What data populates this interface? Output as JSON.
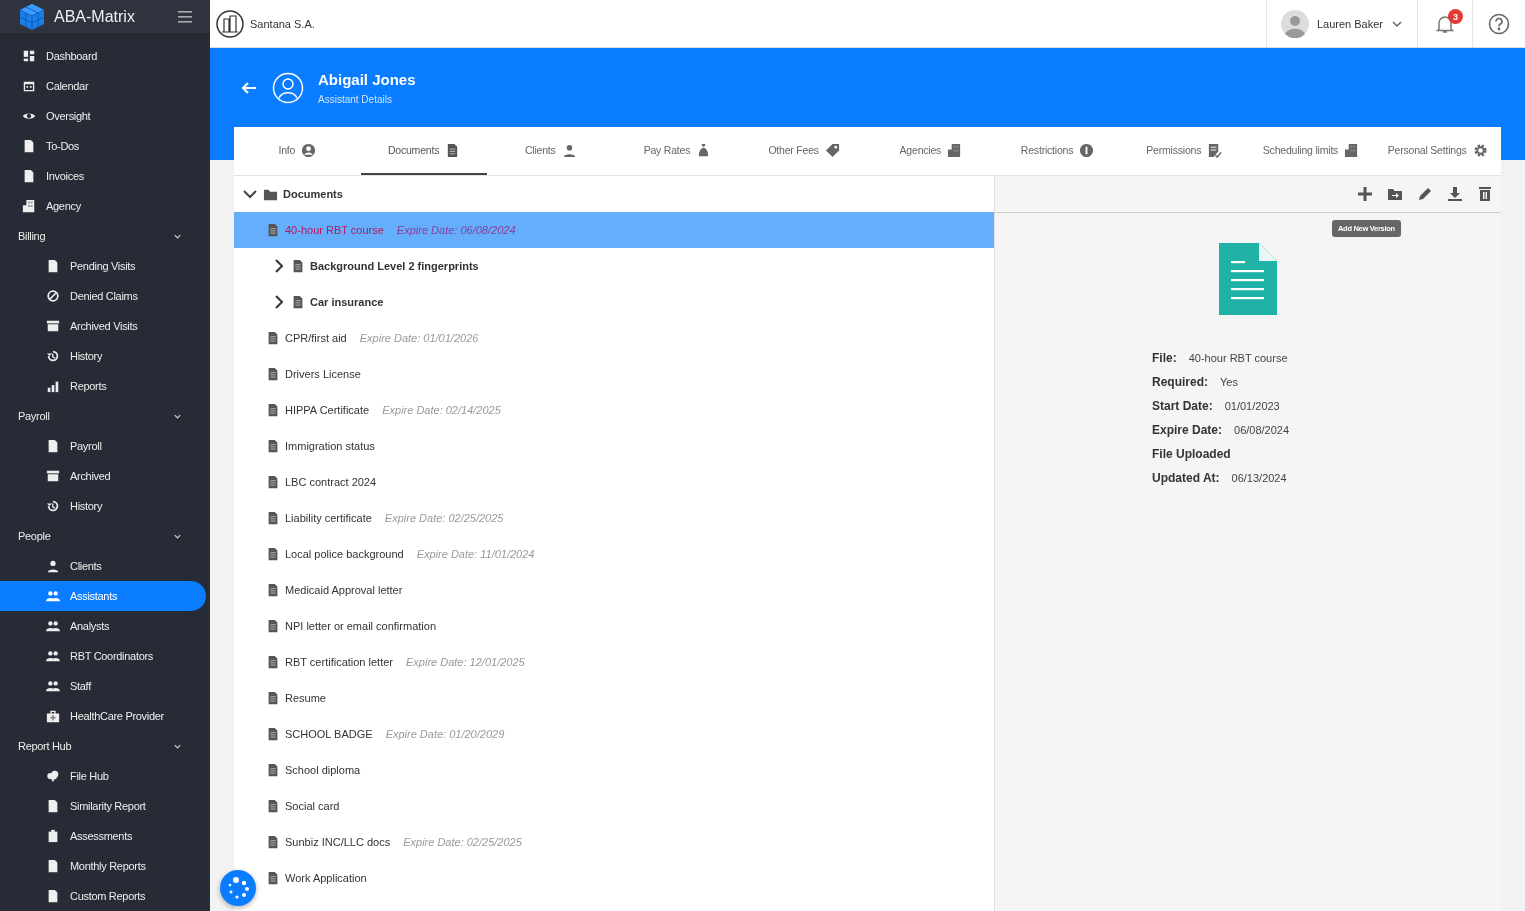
{
  "sidebar": {
    "brand": "ABA-Matrix",
    "items": [
      {
        "label": "Dashboard",
        "selected": false
      },
      {
        "label": "Calendar",
        "selected": false
      },
      {
        "label": "Oversight",
        "selected": false
      },
      {
        "label": "To-Dos",
        "selected": false
      },
      {
        "label": "Invoices",
        "selected": false
      },
      {
        "label": "Agency",
        "selected": false
      }
    ],
    "sections": [
      {
        "title": "Billing",
        "expanded": true,
        "items": [
          {
            "label": "Pending Visits",
            "selected": false
          },
          {
            "label": "Denied Claims",
            "selected": false
          },
          {
            "label": "Archived Visits",
            "selected": false
          },
          {
            "label": "History",
            "selected": false
          },
          {
            "label": "Reports",
            "selected": false
          }
        ]
      },
      {
        "title": "Payroll",
        "expanded": true,
        "items": [
          {
            "label": "Payroll",
            "selected": false
          },
          {
            "label": "Archived",
            "selected": false
          },
          {
            "label": "History",
            "selected": false
          }
        ]
      },
      {
        "title": "People",
        "expanded": true,
        "items": [
          {
            "label": "Clients",
            "selected": false
          },
          {
            "label": "Assistants",
            "selected": true
          },
          {
            "label": "Analysts",
            "selected": false
          },
          {
            "label": "RBT Coordinators",
            "selected": false
          },
          {
            "label": "Staff",
            "selected": false
          },
          {
            "label": "HealthCare Provider",
            "selected": false
          }
        ]
      },
      {
        "title": "Report Hub",
        "expanded": true,
        "items": [
          {
            "label": "File Hub",
            "selected": false
          },
          {
            "label": "Similarity Report",
            "selected": false
          },
          {
            "label": "Assessments",
            "selected": false
          },
          {
            "label": "Monthly Reports",
            "selected": false
          },
          {
            "label": "Custom Reports",
            "selected": false
          }
        ]
      }
    ]
  },
  "topbar": {
    "company": "Santana S.A.",
    "user": "Lauren Baker",
    "notifications": "3"
  },
  "header": {
    "name": "Abigail Jones",
    "subtitle": "Assistant Details"
  },
  "tabs": [
    {
      "label": "Info",
      "selected": false
    },
    {
      "label": "Documents",
      "selected": true
    },
    {
      "label": "Clients",
      "selected": false
    },
    {
      "label": "Pay Rates",
      "selected": false
    },
    {
      "label": "Other Fees",
      "selected": false
    },
    {
      "label": "Agencies",
      "selected": false
    },
    {
      "label": "Restrictions",
      "selected": false
    },
    {
      "label": "Permissions",
      "selected": false
    },
    {
      "label": "Scheduling limits",
      "selected": false
    },
    {
      "label": "Personal Settings",
      "selected": false
    }
  ],
  "tree": {
    "label": "Documents",
    "expanded": true,
    "children": [
      {
        "kind": "file",
        "label": "40-hour RBT course",
        "expire": "Expire Date: 06/08/2024",
        "selected": true
      },
      {
        "kind": "folder",
        "label": "Background Level 2 fingerprints",
        "expanded": false,
        "selected": false
      },
      {
        "kind": "folder",
        "label": "Car insurance",
        "expanded": false,
        "selected": false
      },
      {
        "kind": "file",
        "label": "CPR/first aid",
        "expire": "Expire Date: 01/01/2026",
        "selected": false
      },
      {
        "kind": "file",
        "label": "Drivers License",
        "selected": false
      },
      {
        "kind": "file",
        "label": "HIPPA Certificate",
        "expire": "Expire Date: 02/14/2025",
        "selected": false
      },
      {
        "kind": "file",
        "label": "Immigration status",
        "selected": false
      },
      {
        "kind": "file",
        "label": "LBC contract 2024",
        "selected": false
      },
      {
        "kind": "file",
        "label": "Liability certificate",
        "expire": "Expire Date: 02/25/2025",
        "selected": false
      },
      {
        "kind": "file",
        "label": "Local police background",
        "expire": "Expire Date: 11/01/2024",
        "selected": false
      },
      {
        "kind": "file",
        "label": "Medicaid Approval letter",
        "selected": false
      },
      {
        "kind": "file",
        "label": "NPI letter or email confirmation",
        "selected": false
      },
      {
        "kind": "file",
        "label": "RBT certification letter",
        "expire": "Expire Date: 12/01/2025",
        "selected": false
      },
      {
        "kind": "file",
        "label": "Resume",
        "selected": false
      },
      {
        "kind": "file",
        "label": "SCHOOL BADGE",
        "expire": "Expire Date: 01/20/2029",
        "selected": false
      },
      {
        "kind": "file",
        "label": "School diploma",
        "selected": false
      },
      {
        "kind": "file",
        "label": "Social card",
        "selected": false
      },
      {
        "kind": "file",
        "label": "Sunbiz INC/LLC docs",
        "expire": "Expire Date: 02/25/2025",
        "selected": false
      },
      {
        "kind": "file",
        "label": "Work Application",
        "selected": false
      }
    ]
  },
  "detail": {
    "tooltip": "Add New Version",
    "fields": [
      {
        "label": "File:",
        "value": "40-hour RBT course"
      },
      {
        "label": "Required:",
        "value": "Yes"
      },
      {
        "label": "Start Date:",
        "value": "01/01/2023"
      },
      {
        "label": "Expire Date:",
        "value": "06/08/2024"
      },
      {
        "label": "File Uploaded"
      },
      {
        "label": "Updated At:",
        "value": "06/13/2024"
      }
    ]
  }
}
